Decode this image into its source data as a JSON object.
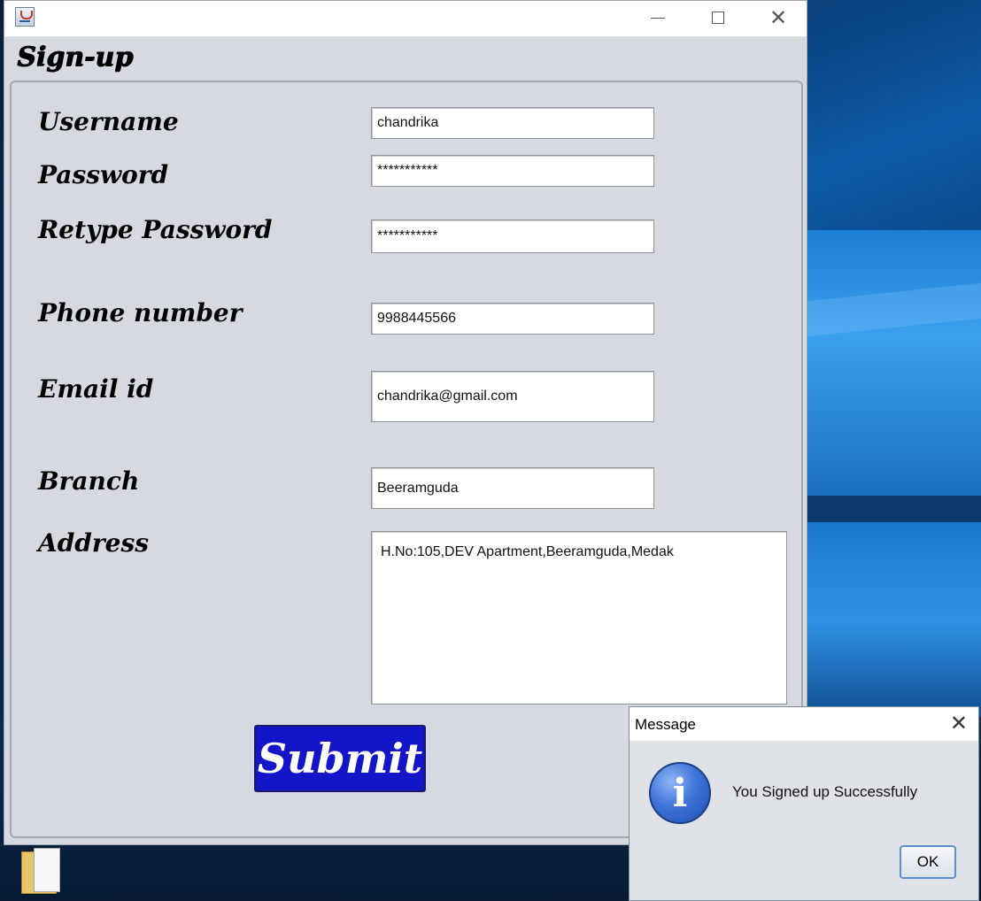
{
  "window": {
    "title": "",
    "heading": "Sign-up",
    "controls": {
      "minimize": "—",
      "maximize": "☐",
      "close": "✕"
    }
  },
  "form": {
    "fields": [
      {
        "label": "Username",
        "value": "chandrika"
      },
      {
        "label": "Password",
        "value": "***********"
      },
      {
        "label": "Retype Password",
        "value": "***********"
      },
      {
        "label": "Phone number",
        "value": "9988445566"
      },
      {
        "label": "Email id",
        "value": "chandrika@gmail.com"
      },
      {
        "label": "Branch",
        "value": "Beeramguda"
      }
    ],
    "address": {
      "label": "Address",
      "value": "H.No:105,DEV Apartment,Beeramguda,Medak"
    },
    "submit_label": "Submit",
    "submit_color": "#1414c8"
  },
  "dialog": {
    "title": "Message",
    "close": "✕",
    "icon": "info-icon",
    "icon_glyph": "i",
    "message": "You Signed up Successfully",
    "ok_label": "OK"
  },
  "desktop": {
    "icons": [
      "folder-icon"
    ]
  }
}
